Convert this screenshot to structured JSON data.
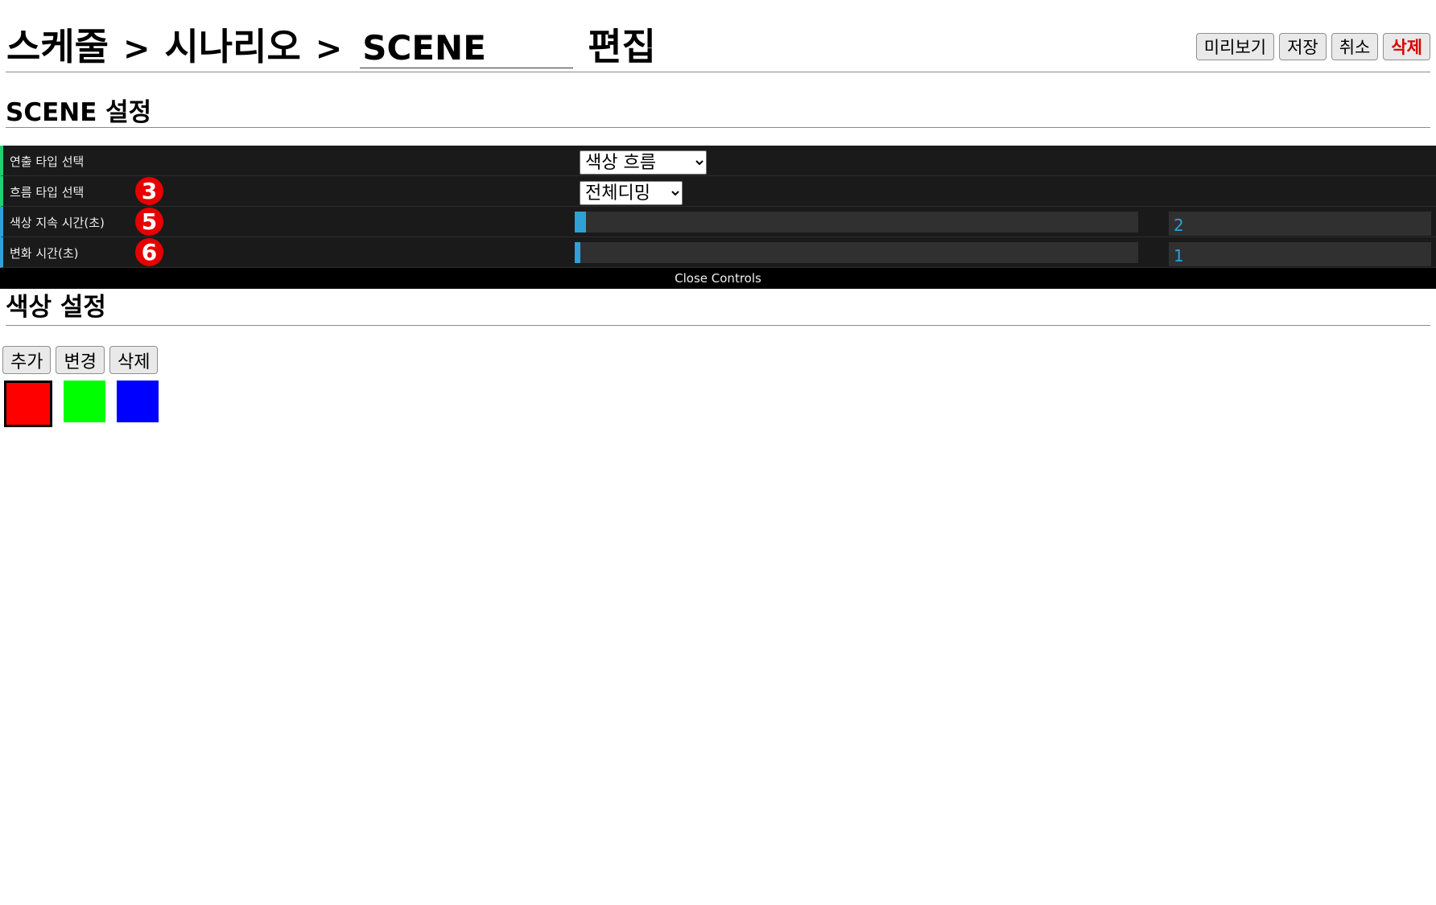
{
  "header": {
    "crumb_schedule": "스케줄",
    "crumb_scenario": "시나리오",
    "separator": ">",
    "scene_name_value": "SCENE",
    "edit_label": "편집",
    "actions": {
      "preview": "미리보기",
      "save": "저장",
      "cancel": "취소",
      "delete": "삭제"
    }
  },
  "scene_settings": {
    "title": "SCENE 설정",
    "rows": {
      "effect_type": {
        "label": "연출 타입 선택",
        "selected": "색상 흐름"
      },
      "flow_type": {
        "label": "흐름 타입 선택",
        "badge": "3",
        "selected": "전체디밍"
      },
      "color_duration": {
        "label": "색상 지속 시간(초)",
        "badge": "5",
        "value": "2",
        "fill_percent": 2
      },
      "transition_time": {
        "label": "변화 시간(초)",
        "badge": "6",
        "value": "1",
        "fill_percent": 1
      }
    },
    "close_controls": "Close Controls"
  },
  "color_settings": {
    "title": "색상 설정",
    "actions": {
      "add": "추가",
      "change": "변경",
      "delete": "삭제"
    },
    "swatches": [
      {
        "color": "#ff0000",
        "selected": true
      },
      {
        "color": "#00ff00",
        "selected": false
      },
      {
        "color": "#0000ff",
        "selected": false
      }
    ]
  },
  "colors": {
    "panel_bg": "#1a1a1a",
    "accent_blue": "#2fa1d6",
    "accent_green": "#1ed36f",
    "badge_red": "#e60000",
    "delete_red": "#d80000"
  }
}
